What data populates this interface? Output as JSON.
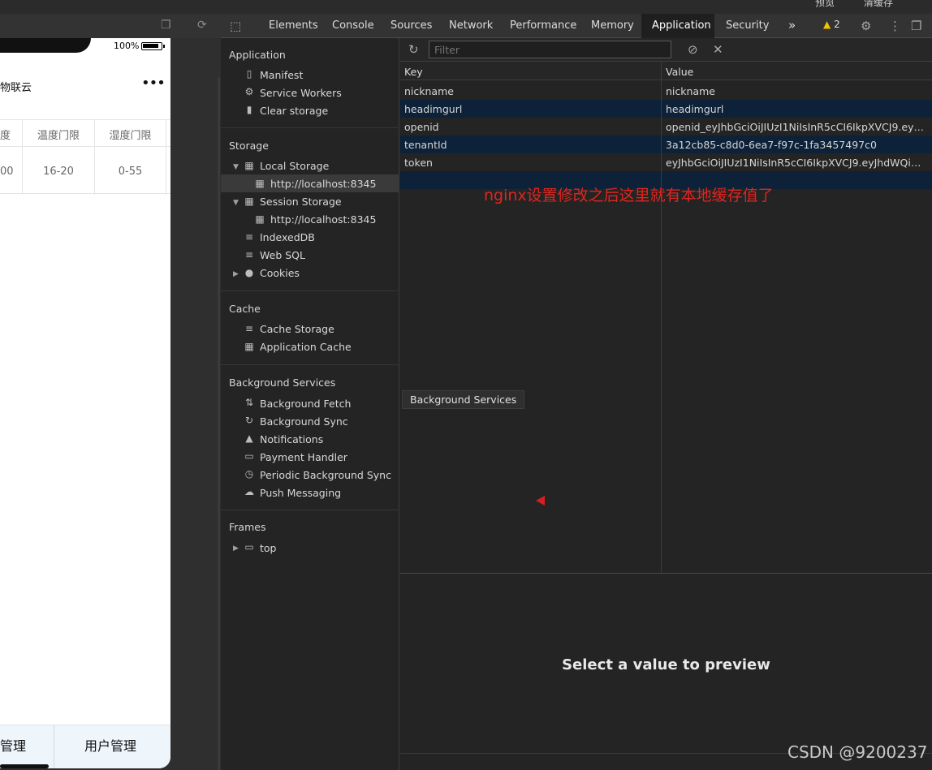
{
  "top_strip": {
    "item1": "预览",
    "item2": "清缓存"
  },
  "phone": {
    "battery_pct": "100%",
    "app_title": "物联云",
    "menu_dots": "•••",
    "table": {
      "headers": [
        "度",
        "温度门限",
        "湿度门限"
      ],
      "row": [
        "00",
        "16-20",
        "0-55"
      ]
    },
    "tabbar": {
      "left": "管理",
      "right": "用户管理"
    }
  },
  "devtools": {
    "tabs": [
      "Elements",
      "Console",
      "Sources",
      "Network",
      "Performance",
      "Memory",
      "Application",
      "Security"
    ],
    "active_tab": "Application",
    "more": "»",
    "warning_count": "2"
  },
  "sidebar": {
    "application": {
      "title": "Application",
      "items": [
        "Manifest",
        "Service Workers",
        "Clear storage"
      ]
    },
    "storage": {
      "title": "Storage",
      "local_storage": "Local Storage",
      "local_origin": "http://localhost:8345",
      "session_storage": "Session Storage",
      "session_origin": "http://localhost:8345",
      "indexeddb": "IndexedDB",
      "websql": "Web SQL",
      "cookies": "Cookies"
    },
    "cache": {
      "title": "Cache",
      "items": [
        "Cache Storage",
        "Application Cache"
      ]
    },
    "background": {
      "title": "Background Services",
      "items": [
        "Background Fetch",
        "Background Sync",
        "Notifications",
        "Payment Handler",
        "Periodic Background Sync",
        "Push Messaging"
      ]
    },
    "frames": {
      "title": "Frames",
      "top": "top"
    }
  },
  "filter": {
    "placeholder": "Filter"
  },
  "grid": {
    "headers": {
      "key": "Key",
      "value": "Value"
    },
    "rows": [
      {
        "key": "nickname",
        "value": "nickname"
      },
      {
        "key": "headimgurl",
        "value": "headimgurl"
      },
      {
        "key": "openid",
        "value": "openid_eyJhbGciOiJIUzI1NiIsInR5cCI6IkpXVCJ9.eyJh..."
      },
      {
        "key": "tenantId",
        "value": "3a12cb85-c8d0-6ea7-f97c-1fa3457497c0"
      },
      {
        "key": "token",
        "value": "eyJhbGciOiJIUzI1NiIsInR5cCI6IkpXVCJ9.eyJhdWQiOiJ..."
      }
    ]
  },
  "annotation": "nginx设置修改之后这里就有本地缓存值了",
  "tooltip": "Background Services",
  "preview": {
    "message": "Select a value to preview"
  },
  "watermark": "CSDN @9200237"
}
